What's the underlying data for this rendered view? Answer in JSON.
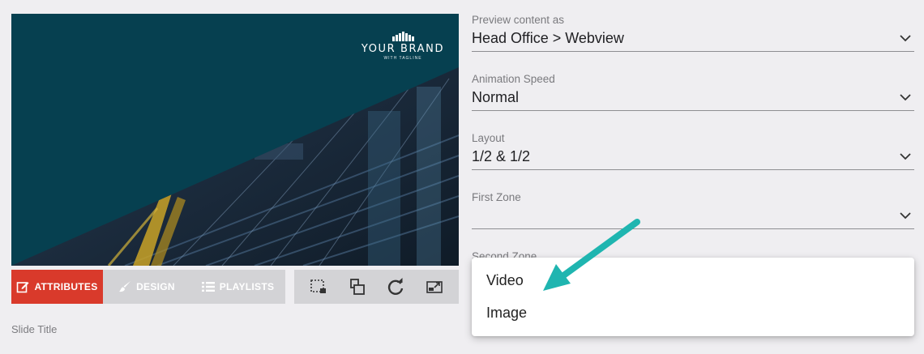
{
  "brand": {
    "name": "YOUR BRAND",
    "tagline": "WITH TAGLINE"
  },
  "toolbar": {
    "tabs": [
      {
        "label": "ATTRIBUTES",
        "icon": "edit-icon"
      },
      {
        "label": "DESIGN",
        "icon": "brush-icon"
      },
      {
        "label": "PLAYLISTS",
        "icon": "list-icon"
      }
    ],
    "actions": [
      "crop-icon",
      "layers-icon",
      "refresh-icon",
      "expand-icon"
    ]
  },
  "slide_title_label": "Slide Title",
  "form": {
    "preview": {
      "label": "Preview content as",
      "value": "Head Office > Webview"
    },
    "animation": {
      "label": "Animation Speed",
      "value": "Normal"
    },
    "layout": {
      "label": "Layout",
      "value": "1/2 & 1/2"
    },
    "first_zone": {
      "label": "First Zone",
      "value": ""
    },
    "second_zone": {
      "label": "Second Zone",
      "value": ""
    }
  },
  "menu": {
    "options": [
      "Video",
      "Image"
    ]
  },
  "colors": {
    "accent": "#d93a2b",
    "preview_bg": "#064050",
    "arrow": "#1fb5b0"
  }
}
